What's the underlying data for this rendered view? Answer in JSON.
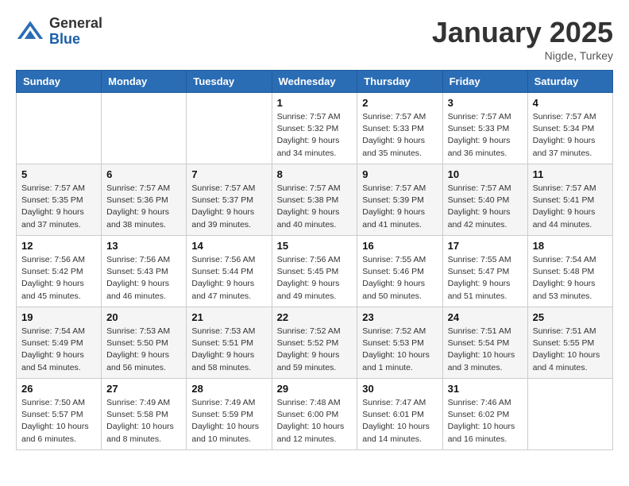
{
  "header": {
    "logo_general": "General",
    "logo_blue": "Blue",
    "month_title": "January 2025",
    "location": "Nigde, Turkey"
  },
  "days_of_week": [
    "Sunday",
    "Monday",
    "Tuesday",
    "Wednesday",
    "Thursday",
    "Friday",
    "Saturday"
  ],
  "weeks": [
    [
      {
        "day": "",
        "info": ""
      },
      {
        "day": "",
        "info": ""
      },
      {
        "day": "",
        "info": ""
      },
      {
        "day": "1",
        "info": "Sunrise: 7:57 AM\nSunset: 5:32 PM\nDaylight: 9 hours\nand 34 minutes."
      },
      {
        "day": "2",
        "info": "Sunrise: 7:57 AM\nSunset: 5:33 PM\nDaylight: 9 hours\nand 35 minutes."
      },
      {
        "day": "3",
        "info": "Sunrise: 7:57 AM\nSunset: 5:33 PM\nDaylight: 9 hours\nand 36 minutes."
      },
      {
        "day": "4",
        "info": "Sunrise: 7:57 AM\nSunset: 5:34 PM\nDaylight: 9 hours\nand 37 minutes."
      }
    ],
    [
      {
        "day": "5",
        "info": "Sunrise: 7:57 AM\nSunset: 5:35 PM\nDaylight: 9 hours\nand 37 minutes."
      },
      {
        "day": "6",
        "info": "Sunrise: 7:57 AM\nSunset: 5:36 PM\nDaylight: 9 hours\nand 38 minutes."
      },
      {
        "day": "7",
        "info": "Sunrise: 7:57 AM\nSunset: 5:37 PM\nDaylight: 9 hours\nand 39 minutes."
      },
      {
        "day": "8",
        "info": "Sunrise: 7:57 AM\nSunset: 5:38 PM\nDaylight: 9 hours\nand 40 minutes."
      },
      {
        "day": "9",
        "info": "Sunrise: 7:57 AM\nSunset: 5:39 PM\nDaylight: 9 hours\nand 41 minutes."
      },
      {
        "day": "10",
        "info": "Sunrise: 7:57 AM\nSunset: 5:40 PM\nDaylight: 9 hours\nand 42 minutes."
      },
      {
        "day": "11",
        "info": "Sunrise: 7:57 AM\nSunset: 5:41 PM\nDaylight: 9 hours\nand 44 minutes."
      }
    ],
    [
      {
        "day": "12",
        "info": "Sunrise: 7:56 AM\nSunset: 5:42 PM\nDaylight: 9 hours\nand 45 minutes."
      },
      {
        "day": "13",
        "info": "Sunrise: 7:56 AM\nSunset: 5:43 PM\nDaylight: 9 hours\nand 46 minutes."
      },
      {
        "day": "14",
        "info": "Sunrise: 7:56 AM\nSunset: 5:44 PM\nDaylight: 9 hours\nand 47 minutes."
      },
      {
        "day": "15",
        "info": "Sunrise: 7:56 AM\nSunset: 5:45 PM\nDaylight: 9 hours\nand 49 minutes."
      },
      {
        "day": "16",
        "info": "Sunrise: 7:55 AM\nSunset: 5:46 PM\nDaylight: 9 hours\nand 50 minutes."
      },
      {
        "day": "17",
        "info": "Sunrise: 7:55 AM\nSunset: 5:47 PM\nDaylight: 9 hours\nand 51 minutes."
      },
      {
        "day": "18",
        "info": "Sunrise: 7:54 AM\nSunset: 5:48 PM\nDaylight: 9 hours\nand 53 minutes."
      }
    ],
    [
      {
        "day": "19",
        "info": "Sunrise: 7:54 AM\nSunset: 5:49 PM\nDaylight: 9 hours\nand 54 minutes."
      },
      {
        "day": "20",
        "info": "Sunrise: 7:53 AM\nSunset: 5:50 PM\nDaylight: 9 hours\nand 56 minutes."
      },
      {
        "day": "21",
        "info": "Sunrise: 7:53 AM\nSunset: 5:51 PM\nDaylight: 9 hours\nand 58 minutes."
      },
      {
        "day": "22",
        "info": "Sunrise: 7:52 AM\nSunset: 5:52 PM\nDaylight: 9 hours\nand 59 minutes."
      },
      {
        "day": "23",
        "info": "Sunrise: 7:52 AM\nSunset: 5:53 PM\nDaylight: 10 hours\nand 1 minute."
      },
      {
        "day": "24",
        "info": "Sunrise: 7:51 AM\nSunset: 5:54 PM\nDaylight: 10 hours\nand 3 minutes."
      },
      {
        "day": "25",
        "info": "Sunrise: 7:51 AM\nSunset: 5:55 PM\nDaylight: 10 hours\nand 4 minutes."
      }
    ],
    [
      {
        "day": "26",
        "info": "Sunrise: 7:50 AM\nSunset: 5:57 PM\nDaylight: 10 hours\nand 6 minutes."
      },
      {
        "day": "27",
        "info": "Sunrise: 7:49 AM\nSunset: 5:58 PM\nDaylight: 10 hours\nand 8 minutes."
      },
      {
        "day": "28",
        "info": "Sunrise: 7:49 AM\nSunset: 5:59 PM\nDaylight: 10 hours\nand 10 minutes."
      },
      {
        "day": "29",
        "info": "Sunrise: 7:48 AM\nSunset: 6:00 PM\nDaylight: 10 hours\nand 12 minutes."
      },
      {
        "day": "30",
        "info": "Sunrise: 7:47 AM\nSunset: 6:01 PM\nDaylight: 10 hours\nand 14 minutes."
      },
      {
        "day": "31",
        "info": "Sunrise: 7:46 AM\nSunset: 6:02 PM\nDaylight: 10 hours\nand 16 minutes."
      },
      {
        "day": "",
        "info": ""
      }
    ]
  ]
}
